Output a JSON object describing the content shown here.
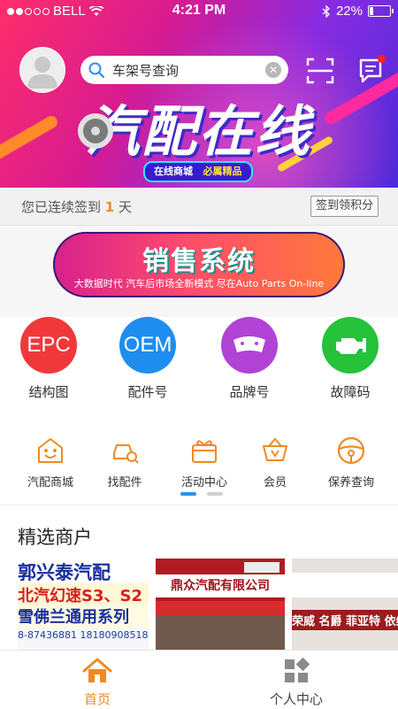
{
  "status_bar": {
    "carrier": "BELL",
    "time": "4:21 PM",
    "battery": "22%",
    "battery_level": 0.22
  },
  "header": {
    "search_placeholder": "车架号查询",
    "banner_title": "汽配在线",
    "banner_tag_left": "在线商城",
    "banner_tag_right": "必属精品"
  },
  "signin": {
    "prefix": "您已连续签到",
    "days": "1",
    "suffix": "天",
    "button": "签到领积分"
  },
  "sales_banner": {
    "title": "销售系统",
    "subtitle": "大数据时代  汽车后市场全新模式  尽在Auto Parts On-line"
  },
  "quick_entries": [
    {
      "badge": "EPC",
      "label": "结构图",
      "color": "#f0383b",
      "icon": "epc-badge"
    },
    {
      "badge": "OEM",
      "label": "配件号",
      "color": "#1f8df0",
      "icon": "oem-badge"
    },
    {
      "badge": "",
      "label": "品牌号",
      "color": "#b043d6",
      "icon": "brake-pad-icon"
    },
    {
      "badge": "",
      "label": "故障码",
      "color": "#25c23a",
      "icon": "engine-warning-icon"
    }
  ],
  "services": [
    {
      "label": "汽配商城",
      "icon": "store-icon"
    },
    {
      "label": "找配件",
      "icon": "car-search-icon"
    },
    {
      "label": "活动中心",
      "icon": "gift-icon"
    },
    {
      "label": "会员",
      "icon": "vip-basket-icon"
    },
    {
      "label": "保养查询",
      "icon": "steering-wheel-icon"
    }
  ],
  "accent_color": "#f08a24",
  "featured": {
    "title": "精选商户",
    "cards": [
      {
        "line1": "郭兴泰汽配",
        "line2": "北汽幻速S3、S2",
        "line3": "雪佛兰通用系列",
        "phones": "8-87436881 18180908518"
      },
      {
        "sign": "鼎众汽配有限公司"
      },
      {
        "sign": "荣威 名爵 菲亚特 依维柯"
      }
    ]
  },
  "tabbar": {
    "home": "首页",
    "me": "个人中心"
  }
}
